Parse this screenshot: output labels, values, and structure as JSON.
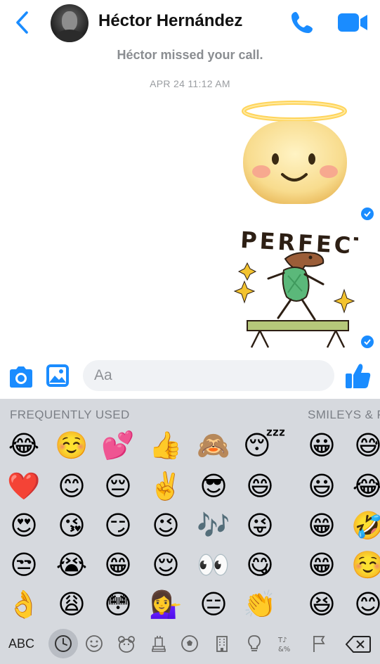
{
  "header": {
    "contact_name": "Héctor Hernández",
    "accent_color": "#1a8cff"
  },
  "thread": {
    "system_message": "Héctor missed your call.",
    "timestamp": "APR 24 11:12 AM",
    "perfect_sticker_text": "PERFECT"
  },
  "composer": {
    "placeholder": "Aa"
  },
  "keyboard": {
    "section_frequent": "FREQUENTLY USED",
    "section_smileys": "SMILEYS & P",
    "abc_label": "ABC",
    "emoji_rows": [
      [
        "😂",
        "☺️",
        "💕",
        "👍",
        "🙈",
        "😴",
        "😀",
        "😅"
      ],
      [
        "❤️",
        "😊",
        "😔",
        "✌️",
        "😎",
        "😄",
        "😃",
        "😂"
      ],
      [
        "😍",
        "😘",
        "😏",
        "😉",
        "🎶",
        "😜",
        "😁",
        "🤣"
      ],
      [
        "😒",
        "😭",
        "😁",
        "😌",
        "👀",
        "😋",
        "😁",
        "☺️"
      ],
      [
        "👌",
        "😩",
        "😳",
        "💁‍♀️",
        "😑",
        "👏",
        "😆",
        "😊"
      ]
    ],
    "category_icons": [
      "clock-icon",
      "smiley-icon",
      "animal-icon",
      "food-icon",
      "ball-icon",
      "building-icon",
      "lightbulb-icon",
      "symbols-icon",
      "flag-icon"
    ]
  }
}
